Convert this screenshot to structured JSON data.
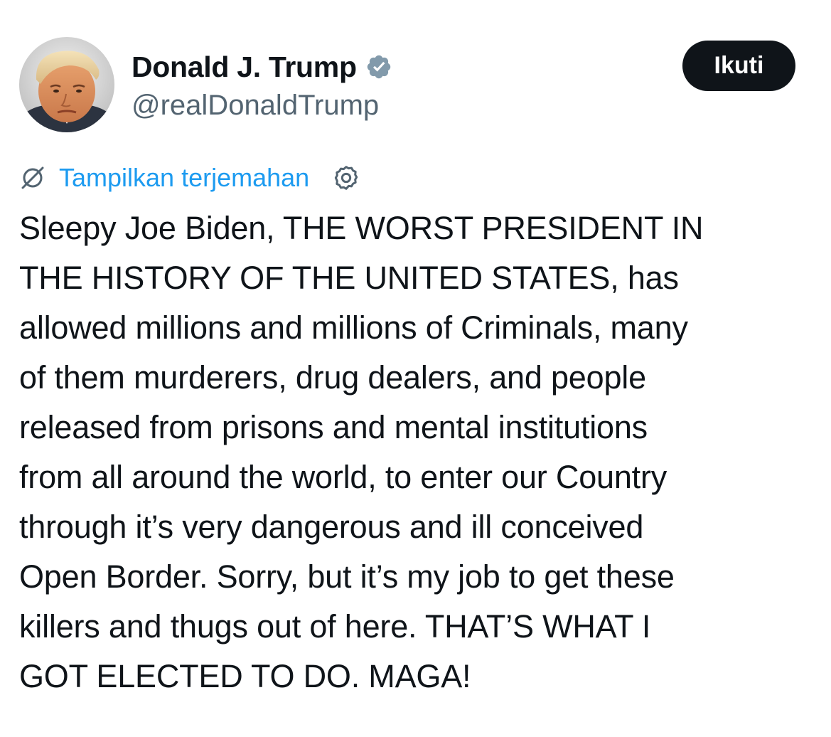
{
  "author": {
    "display_name": "Donald J. Trump",
    "handle": "@realDonaldTrump",
    "verified": true,
    "verified_badge_color": "#829aab",
    "avatar_icon": "profile-photo"
  },
  "actions": {
    "follow_label": "Ikuti"
  },
  "translate": {
    "icon": "globe-slash-icon",
    "label": "Tampilkan terjemahan",
    "settings_icon": "gear-icon",
    "link_color": "#1d9bf0"
  },
  "tweet": {
    "lines": [
      "Sleepy Joe Biden, THE WORST PRESIDENT IN",
      "THE HISTORY OF THE UNITED STATES, has",
      "allowed millions and millions of Criminals, many",
      "of them murderers, drug dealers, and people",
      "released from prisons and mental institutions",
      "from all around the world, to enter our Country",
      "through it’s very dangerous and ill conceived",
      "Open Border. Sorry, but it’s my job to get these",
      "killers and thugs out of here. THAT’S WHAT I",
      "GOT ELECTED TO DO. MAGA!"
    ]
  }
}
